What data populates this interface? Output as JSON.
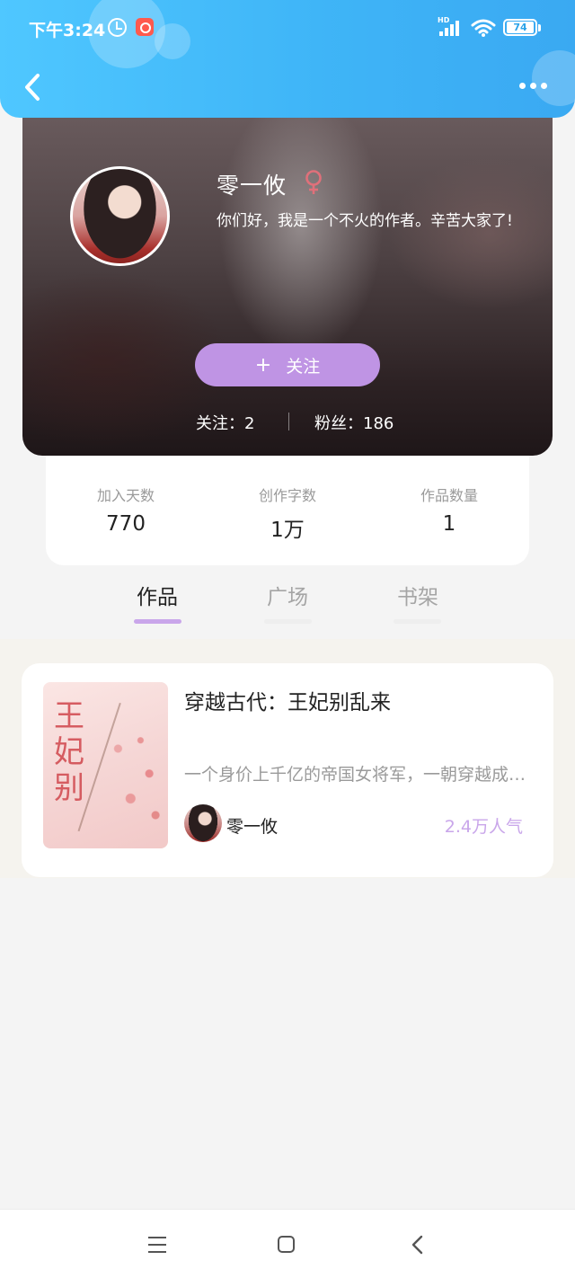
{
  "status_bar": {
    "time": "下午3:24",
    "network": "HD",
    "battery": "74"
  },
  "header": {
    "back_icon": "chevron-left-icon",
    "more_icon": "more-dots-icon",
    "accent_color": "#3fb5f7"
  },
  "profile": {
    "name": "零一攸",
    "gender_icon": "female-icon",
    "gender_color": "#e0707a",
    "intro": "你们好，我是一个不火的作者。辛苦大家了!",
    "follow_button": "关注",
    "follow_plus": "+",
    "following_label": "关注：2",
    "fans_label": "粉丝：186"
  },
  "stats": [
    {
      "label": "加入天数",
      "value": "770"
    },
    {
      "label": "创作字数",
      "value": "1万"
    },
    {
      "label": "作品数量",
      "value": "1"
    }
  ],
  "tabs": [
    {
      "label": "作品",
      "active": true
    },
    {
      "label": "广场",
      "active": false
    },
    {
      "label": "书架",
      "active": false
    }
  ],
  "books": [
    {
      "title": "穿越古代：王妃别乱来",
      "description": "一个身价上千亿的帝国女将军，一朝穿越成了王妃",
      "author": "零一攸",
      "popularity": "2.4万人气",
      "cover_art_text": "王妃别"
    }
  ],
  "bottom_nav": {
    "menu_icon": "menu-icon",
    "home_icon": "home-icon",
    "back_icon": "back-icon"
  },
  "theme": {
    "purple": "#bf94e4",
    "light_purple": "#c9a6ea"
  }
}
